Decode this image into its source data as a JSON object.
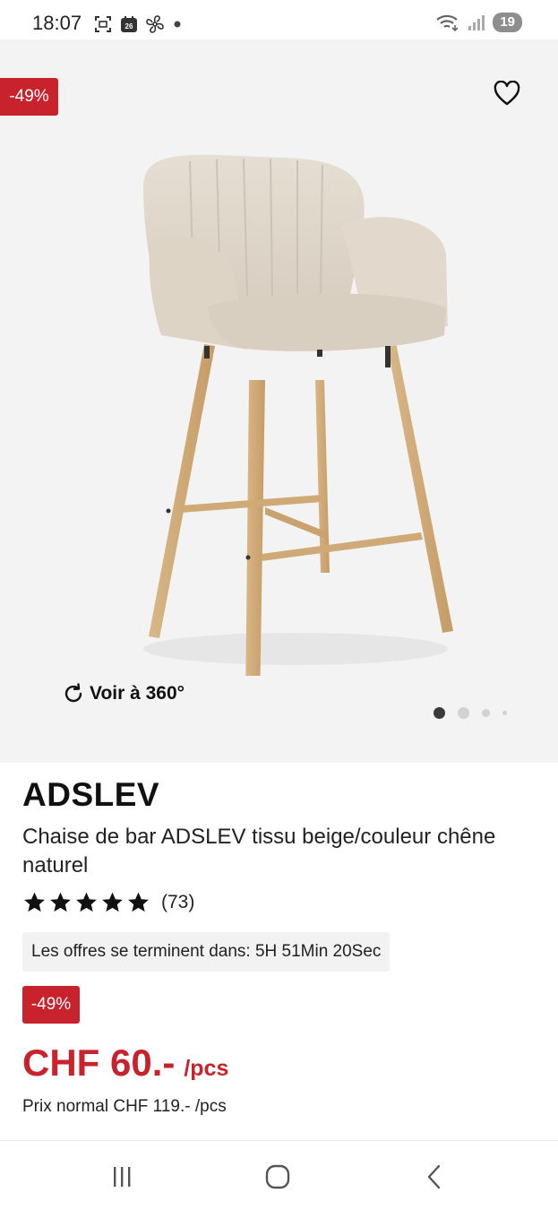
{
  "status_bar": {
    "time": "18:07",
    "calendar_day": "26",
    "battery": "19",
    "icons": [
      "screenshot-icon",
      "calendar-icon",
      "fan-icon",
      "dot-icon",
      "wifi-icon",
      "signal-icon"
    ]
  },
  "product_image": {
    "discount_badge": "-49%",
    "view360_label": "Voir à 360°",
    "carousel": {
      "total": 4,
      "active": 0
    }
  },
  "product": {
    "brand": "ADSLEV",
    "name": "Chaise de bar ADSLEV tissu beige/couleur chêne naturel",
    "rating": {
      "value": 5,
      "max": 5,
      "count": "(73)"
    },
    "offer_text": "Les offres se terminent dans: 5H 51Min 20Sec",
    "discount_badge": "-49%",
    "price": "CHF 60.-",
    "price_unit": "/pcs",
    "normal_price": "Prix normal CHF 119.- /pcs"
  },
  "colors": {
    "accent_red": "#c8232c",
    "image_bg": "#f3f3f3",
    "offer_bg": "#f2f2f2"
  },
  "nav_bar": {
    "buttons": [
      "recent-apps-icon",
      "home-icon",
      "back-icon"
    ]
  }
}
